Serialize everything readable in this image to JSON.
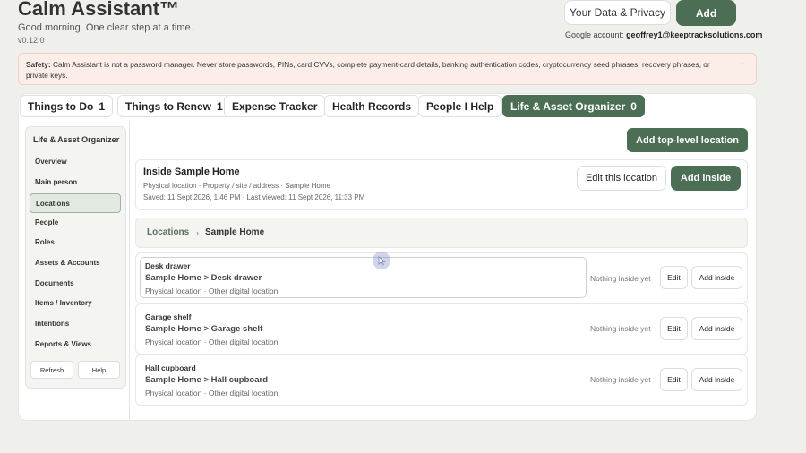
{
  "header": {
    "title": "Calm Assistant™",
    "subtitle": "Good morning. One clear step at a time.",
    "version": "v0.12.0",
    "privacy_label": "Your Data & Privacy",
    "add_label": "Add",
    "account_prefix": "Google account:",
    "account_email": "geoffrey1@keeptracksolutions.com"
  },
  "safety": {
    "label": "Safety:",
    "text": "Calm Assistant is not a password manager. Never store passwords, PINs, card CVVs, complete payment-card details, banking authentication codes, cryptocurrency seed phrases, recovery phrases, or private keys.",
    "close": "–"
  },
  "tabs": [
    {
      "label": "Things to Do",
      "count": "1"
    },
    {
      "label": "Things to Renew",
      "count": "1"
    },
    {
      "label": "Expense Tracker",
      "count": ""
    },
    {
      "label": "Health Records",
      "count": ""
    },
    {
      "label": "People I Help",
      "count": ""
    },
    {
      "label": "Life & Asset Organizer",
      "count": "0"
    }
  ],
  "sidebar": {
    "heading": "Life & Asset Organizer",
    "items": [
      "Overview",
      "Main person",
      "Locations",
      "People",
      "Roles",
      "Assets & Accounts",
      "Documents",
      "Items / Inventory",
      "Intentions",
      "Reports & Views"
    ],
    "active": "Locations",
    "refresh": "Refresh",
    "help": "Help"
  },
  "main": {
    "add_top_location": "Add top-level location",
    "location_title": "Inside Sample Home",
    "location_meta": "Physical location · Property / site / address · Sample Home",
    "location_saved": "Saved: 11 Sept 2026, 1:46 PM · Last viewed: 11 Sept 2026, 11:33 PM",
    "edit_location": "Edit this location",
    "add_inside": "Add inside",
    "breadcrumb_root": "Locations",
    "breadcrumb_sep": "›",
    "breadcrumb_current": "Sample Home",
    "rows": [
      {
        "name": "Desk drawer",
        "path": "Sample Home > Desk drawer",
        "meta": "Physical location · Other digital location",
        "status": "Nothing inside yet",
        "edit": "Edit",
        "add": "Add inside"
      },
      {
        "name": "Garage shelf",
        "path": "Sample Home > Garage shelf",
        "meta": "Physical location · Other digital location",
        "status": "Nothing inside yet",
        "edit": "Edit",
        "add": "Add inside"
      },
      {
        "name": "Hall cupboard",
        "path": "Sample Home > Hall cupboard",
        "meta": "Physical location · Other digital location",
        "status": "Nothing inside yet",
        "edit": "Edit",
        "add": "Add inside"
      }
    ]
  },
  "colors": {
    "accent": "#4c6e55",
    "background": "#efefec",
    "safety_bg": "#fbeee9"
  }
}
